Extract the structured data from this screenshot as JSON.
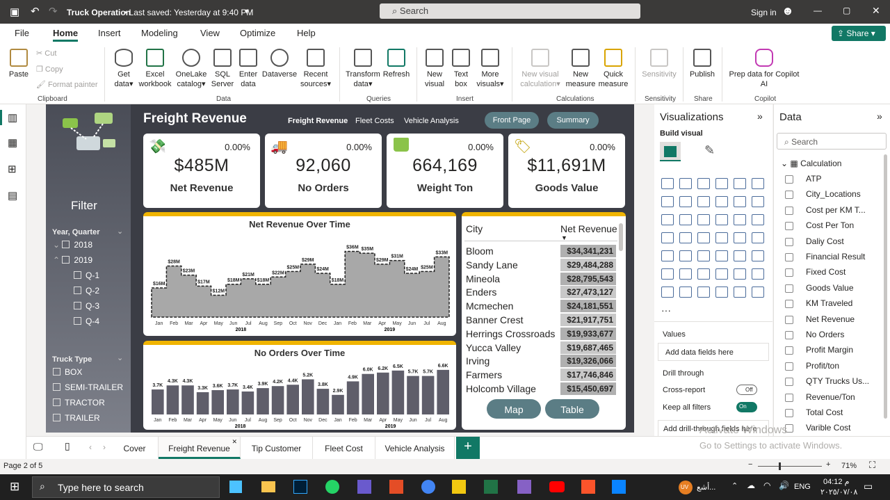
{
  "titlebar": {
    "file_title": "Truck Operation",
    "saved": "• Last saved: Yesterday at 9:40 PM",
    "search": "Search",
    "sign_in": "Sign in"
  },
  "ribbon_tabs": [
    "File",
    "Home",
    "Insert",
    "Modeling",
    "View",
    "Optimize",
    "Help"
  ],
  "share": "Share",
  "ribbon": {
    "paste": "Paste",
    "cut": "Cut",
    "copy": "Copy",
    "format_painter": "Format painter",
    "clipboard": "Clipboard",
    "get_data": "Get data",
    "excel": "Excel workbook",
    "onelake": "OneLake catalog",
    "sql": "SQL Server",
    "enter_data": "Enter data",
    "dataverse": "Dataverse",
    "recent": "Recent sources",
    "data_group": "Data",
    "transform": "Transform data",
    "refresh": "Refresh",
    "queries": "Queries",
    "new_visual": "New visual",
    "text_box": "Text box",
    "more_visuals": "More visuals",
    "insert_group": "Insert",
    "new_visual_calc": "New visual calculation",
    "new_measure": "New measure",
    "quick_measure": "Quick measure",
    "calc_group": "Calculations",
    "sensitivity": "Sensitivity",
    "sensitivity_group": "Sensitivity",
    "publish": "Publish",
    "share_group": "Share",
    "copilot": "Prep data for Copilot AI",
    "copilot_group": "Copilot"
  },
  "report": {
    "title": "Freight Revenue",
    "nav": [
      "Freight Revenue",
      "Fleet Costs",
      "Vehicle Analysis"
    ],
    "btn_front": "Front Page",
    "btn_summary": "Summary",
    "filter_title": "Filter",
    "year_quarter": "Year, Quarter",
    "y2018": "2018",
    "y2019": "2019",
    "quarters": [
      "Q-1",
      "Q-2",
      "Q-3",
      "Q-4"
    ],
    "truck_type": "Truck Type",
    "truck_types": [
      "BOX",
      "SEMI-TRAILER",
      "TRACTOR",
      "TRAILER"
    ],
    "kpis": [
      {
        "value": "$485M",
        "label": "Net Revenue",
        "pct": "0.00%"
      },
      {
        "value": "92,060",
        "label": "No Orders",
        "pct": "0.00%"
      },
      {
        "value": "664,169",
        "label": "Weight Ton",
        "pct": "0.00%"
      },
      {
        "value": "$11,691M",
        "label": "Goods Value",
        "pct": "0.00%"
      }
    ],
    "table_city": "City",
    "table_rev": "Net Revenue",
    "btn_map": "Map",
    "btn_table": "Table"
  },
  "chart_data": [
    {
      "type": "area",
      "title": "Net Revenue Over Time",
      "categories": [
        "Jan",
        "Feb",
        "Mar",
        "Apr",
        "May",
        "Jun",
        "Jul",
        "Aug",
        "Sep",
        "Oct",
        "Nov",
        "Dec",
        "Jan",
        "Feb",
        "Mar",
        "Apr",
        "May",
        "Jun",
        "Jul",
        "Aug"
      ],
      "years": [
        "2018",
        "2019"
      ],
      "values": [
        16,
        28,
        23,
        17,
        12,
        18,
        21,
        18,
        22,
        25,
        29,
        24,
        18,
        36,
        35,
        29,
        31,
        24,
        25,
        33
      ],
      "labels": [
        "$16M",
        "$28M",
        "$23M",
        "$17M",
        "$12M",
        "$18M",
        "$21M",
        "$18M",
        "$22M",
        "$25M",
        "$29M",
        "$24M",
        "$18M",
        "$36M",
        "$35M",
        "$29M",
        "$31M",
        "$24M",
        "$25M",
        "$33M"
      ]
    },
    {
      "type": "bar",
      "title": "No Orders Over Time",
      "categories": [
        "Jan",
        "Feb",
        "Mar",
        "Apr",
        "May",
        "Jun",
        "Jul",
        "Aug",
        "Sep",
        "Oct",
        "Nov",
        "Dec",
        "Jan",
        "Feb",
        "Mar",
        "Apr",
        "May",
        "Jun",
        "Jul",
        "Aug"
      ],
      "years": [
        "2018",
        "2019"
      ],
      "values": [
        3.7,
        4.3,
        4.3,
        3.3,
        3.6,
        3.7,
        3.4,
        3.9,
        4.2,
        4.4,
        5.2,
        3.8,
        2.9,
        4.9,
        6.0,
        6.2,
        6.5,
        5.7,
        5.7,
        6.6
      ],
      "labels": [
        "3.7K",
        "4.3K",
        "4.3K",
        "3.3K",
        "3.6K",
        "3.7K",
        "3.4K",
        "3.9K",
        "4.2K",
        "4.4K",
        "5.2K",
        "3.8K",
        "2.9K",
        "4.9K",
        "6.0K",
        "6.2K",
        "6.5K",
        "5.7K",
        "5.7K",
        "6.6K"
      ]
    },
    {
      "type": "table",
      "columns": [
        "City",
        "Net Revenue"
      ],
      "rows": [
        [
          "Bloom",
          "$34,341,231"
        ],
        [
          "Sandy Lane",
          "$29,484,288"
        ],
        [
          "Mineola",
          "$28,795,543"
        ],
        [
          "Enders",
          "$27,473,127"
        ],
        [
          "Mcmechen",
          "$24,181,551"
        ],
        [
          "Banner Crest",
          "$21,917,751"
        ],
        [
          "Herrings Crossroads",
          "$19,933,677"
        ],
        [
          "Yucca Valley",
          "$19,687,465"
        ],
        [
          "Irving",
          "$19,326,066"
        ],
        [
          "Farmers",
          "$17,746,846"
        ],
        [
          "Holcomb Village",
          "$15,450,697"
        ]
      ]
    }
  ],
  "viz": {
    "title": "Visualizations",
    "build": "Build visual",
    "values": "Values",
    "add_fields": "Add data fields here",
    "drill": "Drill through",
    "cross": "Cross-report",
    "cross_state": "Off",
    "keep": "Keep all filters",
    "keep_state": "On",
    "add_drill": "Add drill-through fields here"
  },
  "data": {
    "title": "Data",
    "search": "Search",
    "table": "Calculation",
    "fields": [
      "ATP",
      "City_Locations",
      "Cost per KM T...",
      "Cost Per Ton",
      "Daliy Cost",
      "Financial Result",
      "Fixed Cost",
      "Goods Value",
      "KM Traveled",
      "Net Revenue",
      "No Orders",
      "Profit Margin",
      "Profit/ton",
      "QTY Trucks Us...",
      "Revenue/Ton",
      "Total Cost",
      "Varible Cost",
      "Weight Ton"
    ]
  },
  "pages": [
    "Cover",
    "Freight Revenue",
    "Tip Customer",
    "Fleet Cost",
    "Vehicle Analysis"
  ],
  "status": {
    "page": "Page 2 of 5",
    "zoom": "71%"
  },
  "watermark": {
    "line1": "Activate Windows",
    "line2": "Go to Settings to activate Windows."
  },
  "taskbar": {
    "search": "Type here to search",
    "time": "04:12 م",
    "date": "٢٠٢٥/٠٧/٠٨",
    "lang": "ENG",
    "user": "أشع..."
  }
}
